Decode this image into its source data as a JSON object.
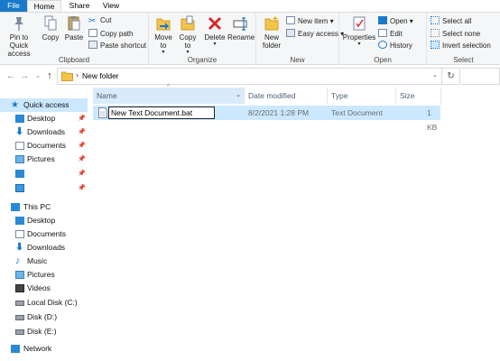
{
  "tabs": {
    "file": "File",
    "home": "Home",
    "share": "Share",
    "view": "View"
  },
  "ribbon": {
    "clipboard": {
      "label": "Clipboard",
      "pin_quick_access": "Pin to Quick access",
      "copy": "Copy",
      "paste": "Paste",
      "cut": "Cut",
      "copy_path": "Copy path",
      "paste_shortcut": "Paste shortcut"
    },
    "organize": {
      "label": "Organize",
      "move_to": "Move to",
      "copy_to": "Copy to",
      "delete": "Delete",
      "rename": "Rename"
    },
    "new": {
      "label": "New",
      "new_folder": "New folder",
      "new_item": "New item",
      "easy_access": "Easy access"
    },
    "open": {
      "label": "Open",
      "properties": "Properties",
      "open": "Open",
      "edit": "Edit",
      "history": "History"
    },
    "select": {
      "label": "Select",
      "select_all": "Select all",
      "select_none": "Select none",
      "invert_selection": "Invert selection"
    }
  },
  "address": {
    "path": "New folder"
  },
  "nav": {
    "quick_access": "Quick access",
    "quick_items": [
      "Desktop",
      "Downloads",
      "Documents",
      "Pictures"
    ],
    "this_pc": "This PC",
    "pc_items": [
      "Desktop",
      "Documents",
      "Downloads",
      "Music",
      "Pictures",
      "Videos",
      "Local Disk (C:)",
      "Disk (D:)",
      "Disk (E:)"
    ],
    "network": "Network"
  },
  "columns": {
    "name": "Name",
    "date": "Date modified",
    "type": "Type",
    "size": "Size"
  },
  "file": {
    "name": "New Text Document.bat",
    "date": "8/2/2021 1:28 PM",
    "type": "Text Document",
    "size": "1 KB"
  },
  "colors": {
    "file_tab": "#1979ca",
    "selection": "#cce8ff",
    "header_hover": "#d9ebf9",
    "folder": "#f3c34a"
  }
}
